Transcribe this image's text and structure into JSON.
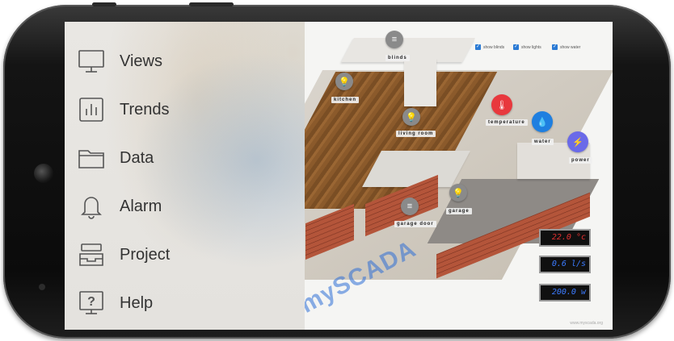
{
  "menu": {
    "items": [
      {
        "label": "Views",
        "icon": "monitor-icon"
      },
      {
        "label": "Trends",
        "icon": "bar-chart-icon"
      },
      {
        "label": "Data",
        "icon": "folder-icon"
      },
      {
        "label": "Alarm",
        "icon": "bell-icon"
      },
      {
        "label": "Project",
        "icon": "tray-icon"
      },
      {
        "label": "Help",
        "icon": "help-icon"
      }
    ]
  },
  "scada": {
    "checkboxes": [
      {
        "label": "show blinds",
        "checked": true
      },
      {
        "label": "show lights",
        "checked": true
      },
      {
        "label": "show water",
        "checked": true
      }
    ],
    "labels": {
      "blinds": "blinds",
      "kitchen": "kitchen",
      "living_room": "living room",
      "temperature": "temperature",
      "water": "water",
      "power": "power",
      "garage_door": "garage door",
      "garage": "garage"
    },
    "logo": "mySCADA",
    "displays": {
      "temperature": "22.0 °c",
      "water": "0.6 l/s",
      "power": "200.0 w"
    },
    "watermark": "www.myscada.org"
  },
  "colors": {
    "temperature_pin": "#e8383d",
    "water_pin": "#1f7fe0",
    "power_pin": "#6a6ae8",
    "light_pin": "#8a8a8a"
  }
}
